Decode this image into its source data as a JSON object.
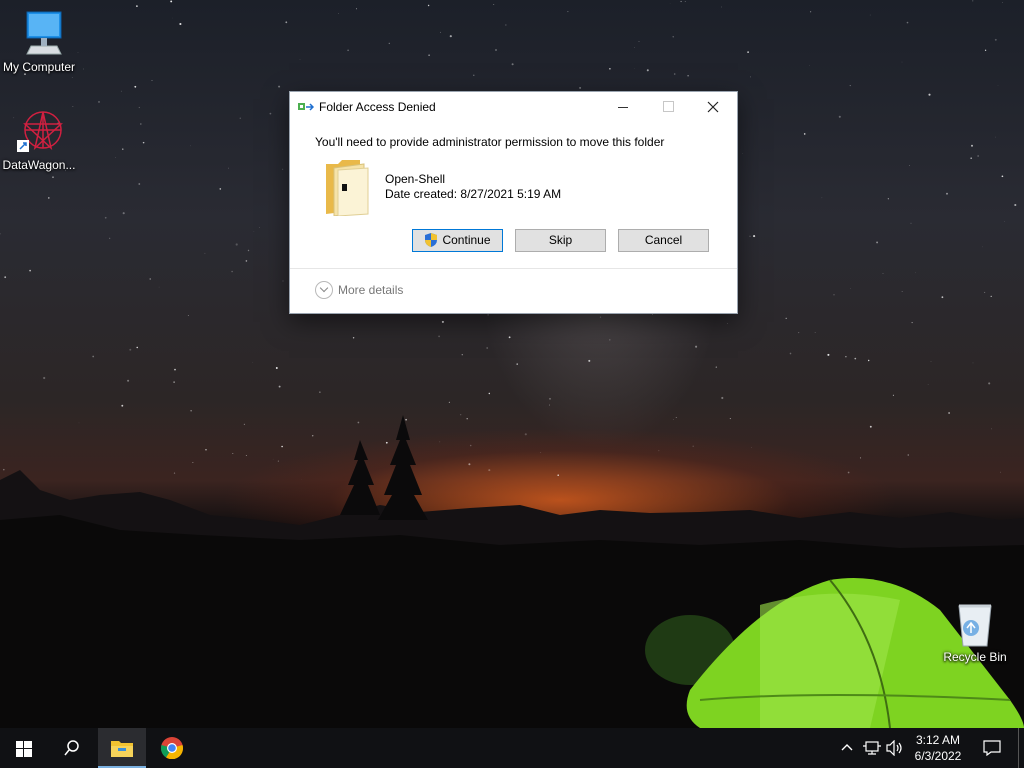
{
  "desktop": {
    "icons": [
      {
        "label": "My Computer",
        "icon": "monitor-icon"
      },
      {
        "label": "DataWagon...",
        "icon": "datawagon-shortcut-icon"
      },
      {
        "label": "Recycle Bin",
        "icon": "recycle-bin-icon"
      }
    ]
  },
  "dialog": {
    "title": "Folder Access Denied",
    "message": "You'll need to provide administrator permission to move this folder",
    "folder_name": "Open-Shell",
    "date_label": "Date created:",
    "date_value": "8/27/2021 5:19 AM",
    "buttons": {
      "continue": "Continue",
      "skip": "Skip",
      "cancel": "Cancel"
    },
    "more_details": "More details",
    "icons": {
      "title": "folder-move-icon",
      "shield": "uac-shield-icon"
    }
  },
  "taskbar": {
    "clock_time": "3:12 AM",
    "clock_date": "6/3/2022",
    "pinned": [
      "windows-start-icon",
      "search-icon",
      "file-explorer-icon",
      "chrome-icon"
    ],
    "tray": [
      "chevron-up-icon",
      "network-icon",
      "volume-icon",
      "notification-icon"
    ]
  },
  "colors": {
    "accent": "#0078d7",
    "tent_green": "#7ed321",
    "taskbar": "#101114"
  }
}
